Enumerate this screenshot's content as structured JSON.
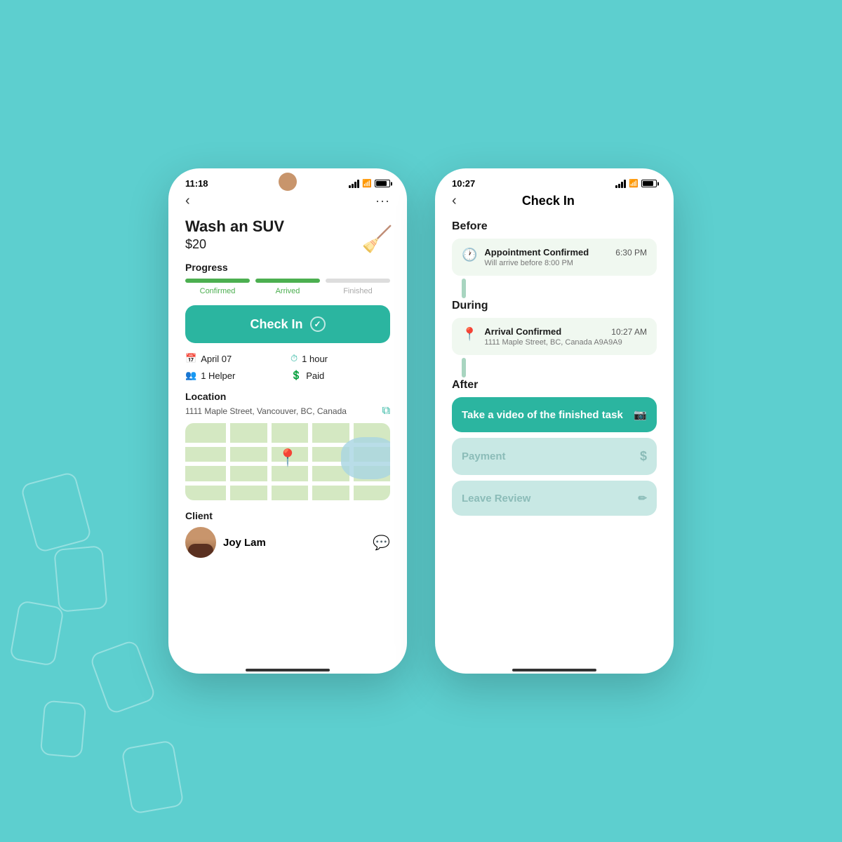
{
  "background": {
    "color": "#5dcfcf"
  },
  "phone_left": {
    "status_bar": {
      "time": "11:18"
    },
    "nav": {
      "back_label": "‹",
      "more_label": "···"
    },
    "task": {
      "title": "Wash an SUV",
      "price": "$20",
      "icon": "🧹"
    },
    "progress": {
      "label": "Progress",
      "steps": [
        {
          "label": "Confirmed",
          "active": true,
          "color": "#4caf50"
        },
        {
          "label": "Arrived",
          "active": true,
          "color": "#4caf50"
        },
        {
          "label": "Finished",
          "active": false,
          "color": "#ddd"
        }
      ]
    },
    "checkin_button": {
      "label": "Check In",
      "icon": "✓"
    },
    "details": [
      {
        "icon": "📅",
        "label": "April 07",
        "color": "#2bb5a0"
      },
      {
        "icon": "⏱",
        "label": "1 hour",
        "color": "#2bb5a0"
      },
      {
        "icon": "👥",
        "label": "1 Helper",
        "color": "#2bb5a0"
      },
      {
        "icon": "💲",
        "label": "Paid",
        "color": "#2bb5a0"
      }
    ],
    "location": {
      "section_label": "Location",
      "address": "1111 Maple Street, Vancouver, BC, Canada"
    },
    "client": {
      "section_label": "Client",
      "name": "Joy Lam"
    }
  },
  "phone_right": {
    "status_bar": {
      "time": "10:27"
    },
    "nav": {
      "back_label": "‹",
      "title": "Check In"
    },
    "sections": {
      "before": {
        "label": "Before",
        "event": {
          "icon": "🕐",
          "title": "Appointment Confirmed",
          "time": "6:30 PM",
          "subtitle": "Will arrive before 8:00 PM"
        }
      },
      "during": {
        "label": "During",
        "event": {
          "icon": "📍",
          "title": "Arrival Confirmed",
          "time": "10:27 AM",
          "subtitle": "1111 Maple Street, BC, Canada A9A9A9"
        }
      },
      "after": {
        "label": "After",
        "buttons": [
          {
            "label": "Take a video of the finished task",
            "icon": "📷",
            "active": true
          },
          {
            "label": "Payment",
            "icon": "$",
            "active": false
          },
          {
            "label": "Leave Review",
            "icon": "✏",
            "active": false
          }
        ]
      }
    }
  }
}
